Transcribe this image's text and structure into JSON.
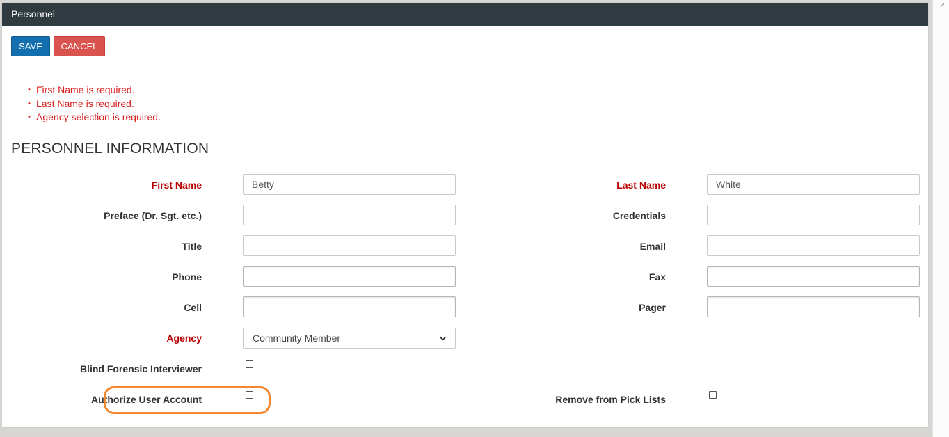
{
  "panel": {
    "title": "Personnel"
  },
  "toolbar": {
    "save_label": "SAVE",
    "cancel_label": "CANCEL"
  },
  "errors": [
    "First Name is required.",
    "Last Name is required.",
    "Agency selection is required."
  ],
  "section_title": "PERSONNEL INFORMATION",
  "fields": {
    "first_name": {
      "label": "First Name",
      "value": "Betty",
      "required": true
    },
    "last_name": {
      "label": "Last Name",
      "value": "White",
      "required": true
    },
    "preface": {
      "label": "Preface (Dr. Sgt. etc.)",
      "value": ""
    },
    "credentials": {
      "label": "Credentials",
      "value": ""
    },
    "title": {
      "label": "Title",
      "value": ""
    },
    "email": {
      "label": "Email",
      "value": ""
    },
    "phone": {
      "label": "Phone",
      "value": ""
    },
    "fax": {
      "label": "Fax",
      "value": ""
    },
    "cell": {
      "label": "Cell",
      "value": ""
    },
    "pager": {
      "label": "Pager",
      "value": ""
    },
    "agency": {
      "label": "Agency",
      "selected": "Community Member",
      "required": true
    }
  },
  "checkboxes": {
    "blind_forensic": {
      "label": "Blind Forensic Interviewer",
      "checked": false
    },
    "authorize_user": {
      "label": "Authorize User Account",
      "checked": false
    },
    "remove_pick_lists": {
      "label": "Remove from Pick Lists",
      "checked": false
    }
  },
  "colors": {
    "header_bg": "#2f3b40",
    "save_button": "#136fad",
    "cancel_button": "#d9534f",
    "error_text": "#d81e1e",
    "required_label": "#b90000",
    "highlight": "#f5882e"
  },
  "icons": {
    "agency_dropdown": "chevron-down-icon"
  }
}
